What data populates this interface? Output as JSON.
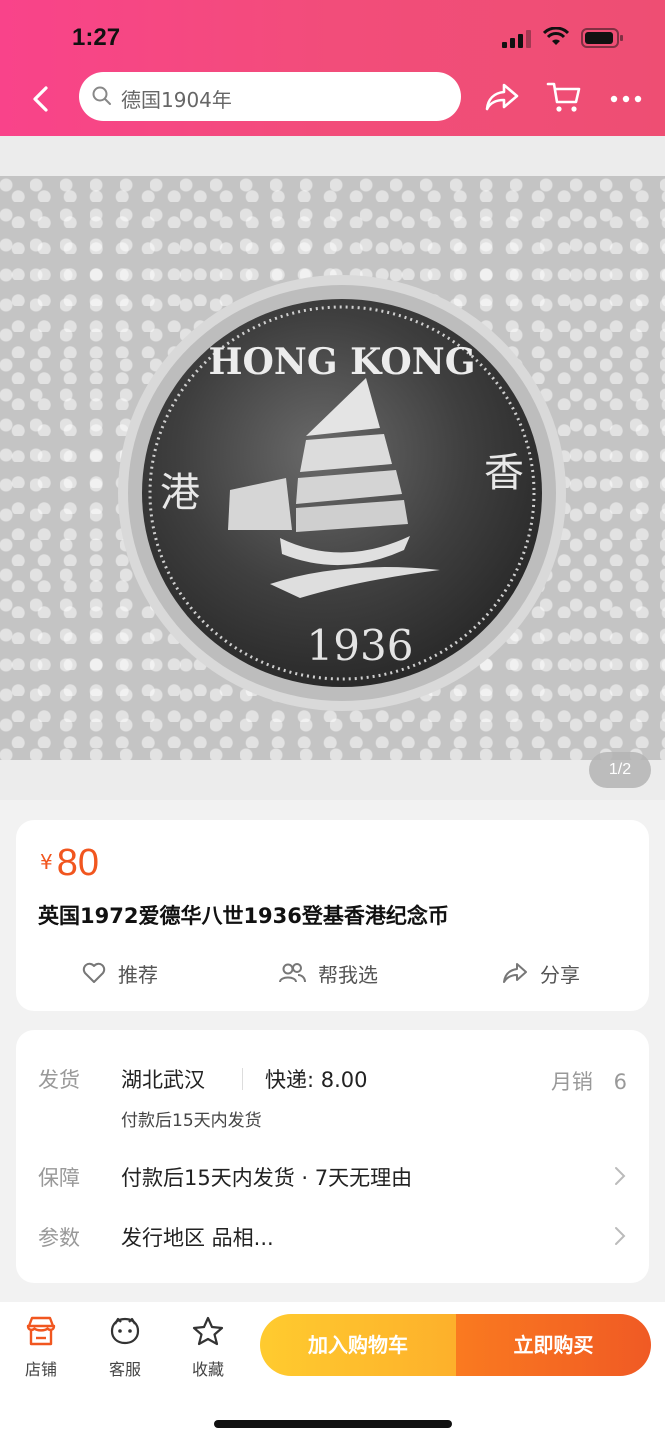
{
  "status_bar": {
    "time": "1:27"
  },
  "header": {
    "search_text": "德国1904年"
  },
  "gallery": {
    "coin_top_text": "HONG KONG",
    "coin_left_char": "港",
    "coin_right_char": "香",
    "coin_year": "1936",
    "pager": "1/2"
  },
  "product": {
    "currency": "¥",
    "price": "80",
    "title": "英国1972爱德华八世1936登基香港纪念币",
    "actions": [
      {
        "label": "推荐",
        "icon": "heart-icon"
      },
      {
        "label": "帮我选",
        "icon": "people-icon"
      },
      {
        "label": "分享",
        "icon": "share-icon"
      }
    ]
  },
  "details": {
    "ship_label": "发货",
    "ship_location": "湖北武汉",
    "ship_fee": "快递: 8.00",
    "monthly_label": "月销",
    "monthly_value": "6",
    "ship_note": "付款后15天内发货",
    "guarantee_label": "保障",
    "guarantee_value": "付款后15天内发货 · 7天无理由",
    "params_label": "参数",
    "params_value": "发行地区 品相..."
  },
  "bottom_bar": {
    "tabs": [
      {
        "label": "店铺",
        "icon": "store-icon"
      },
      {
        "label": "客服",
        "icon": "service-icon"
      },
      {
        "label": "收藏",
        "icon": "star-icon"
      }
    ],
    "add_to_cart": "加入购物车",
    "buy_now": "立即购买"
  },
  "colors": {
    "header_pink": "#f24d7a",
    "price_orange": "#f1561f",
    "cart_yellow": "#fdb02b",
    "buy_orange": "#f05a24"
  }
}
